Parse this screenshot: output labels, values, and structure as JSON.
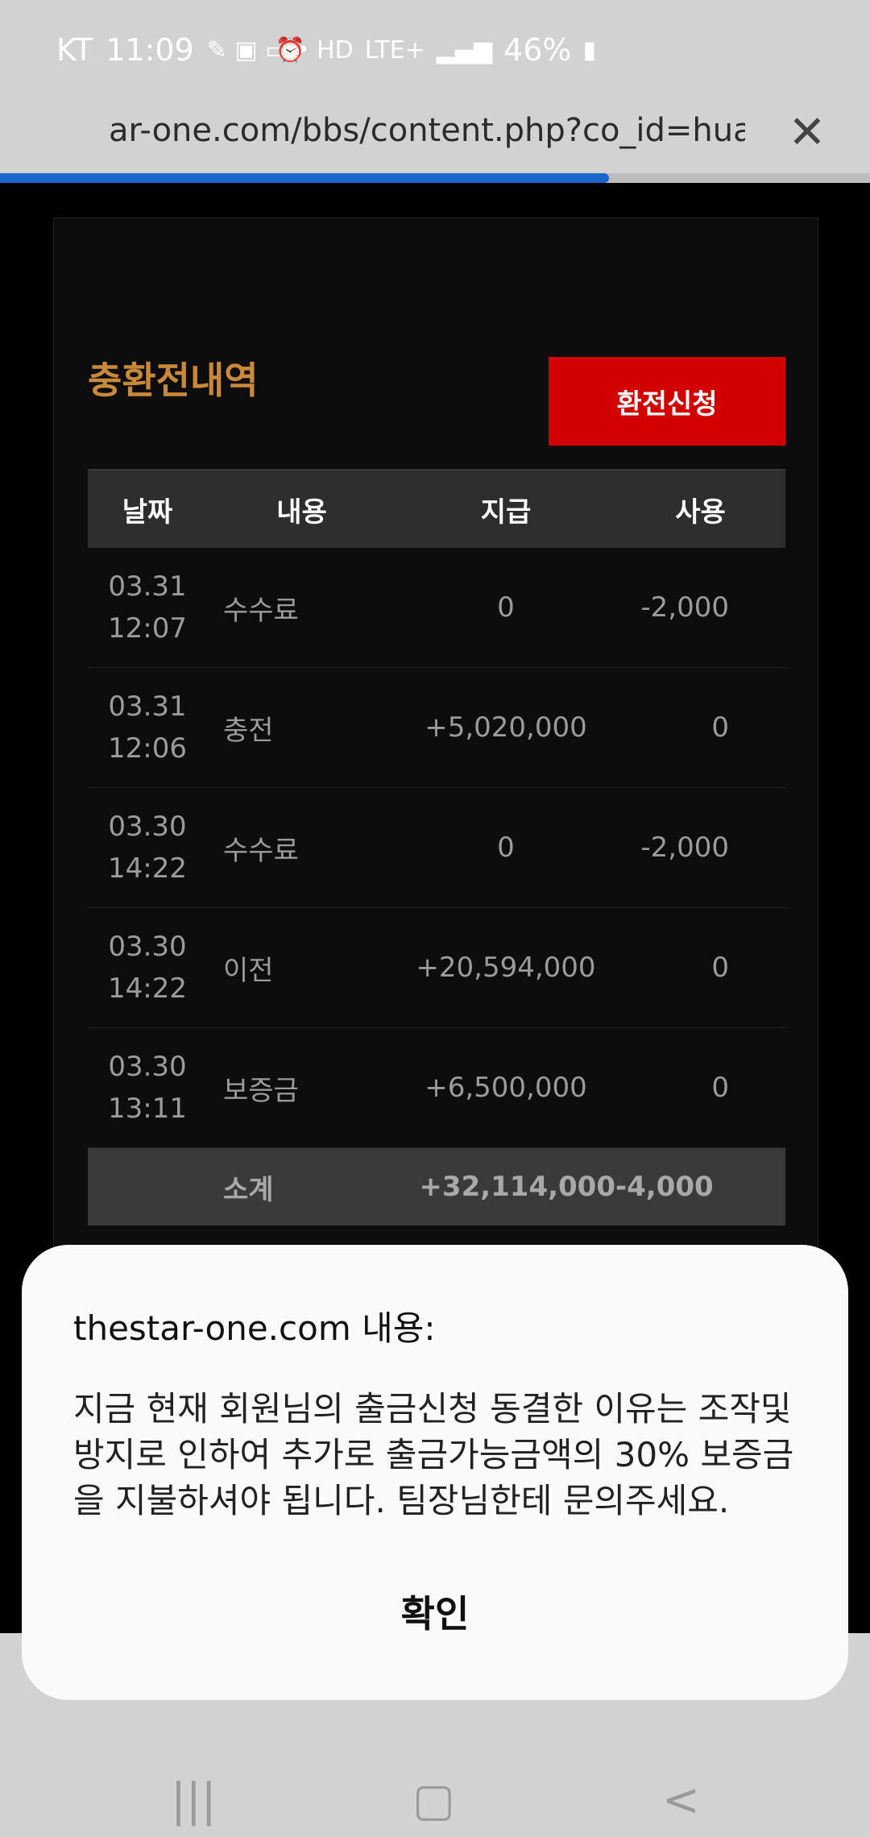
{
  "status_bar": {
    "carrier": "KT",
    "time": "11:09",
    "battery": "46%",
    "network": "LTE+"
  },
  "browser": {
    "url": "ar-one.com/bbs/content.php?co_id=huan",
    "load_progress": 0.7
  },
  "section": {
    "title": "충환전내역",
    "exchange_button": "환전신청"
  },
  "table": {
    "headers": [
      "날짜",
      "내용",
      "지급",
      "사용"
    ],
    "rows": [
      {
        "date": "03.31",
        "time": "12:07",
        "desc": "수수료",
        "paid": "0",
        "used": "-2,000"
      },
      {
        "date": "03.31",
        "time": "12:06",
        "desc": "충전",
        "paid": "+5,020,000",
        "used": "0"
      },
      {
        "date": "03.30",
        "time": "14:22",
        "desc": "수수료",
        "paid": "0",
        "used": "-2,000"
      },
      {
        "date": "03.30",
        "time": "14:22",
        "desc": "이전",
        "paid": "+20,594,000",
        "used": "0"
      },
      {
        "date": "03.30",
        "time": "13:11",
        "desc": "보증금",
        "paid": "+6,500,000",
        "used": "0"
      }
    ],
    "subtotal": {
      "label": "소계",
      "paid": "+32,114,000",
      "used": "-4,000"
    }
  },
  "dialog": {
    "title": "thestar-one.com 내용:",
    "message": "지금  현재 회원님의 출금신청 동결한 이유는 조작및방지로 인하여 추가로 출금가능금액의 30%  보증금을  지불하셔야  됩니다. 팀장님한테 문의주세요.",
    "ok_label": "확인"
  },
  "nav": {
    "recents_icon": "|||",
    "home_icon": "▢",
    "back_icon": "<"
  }
}
